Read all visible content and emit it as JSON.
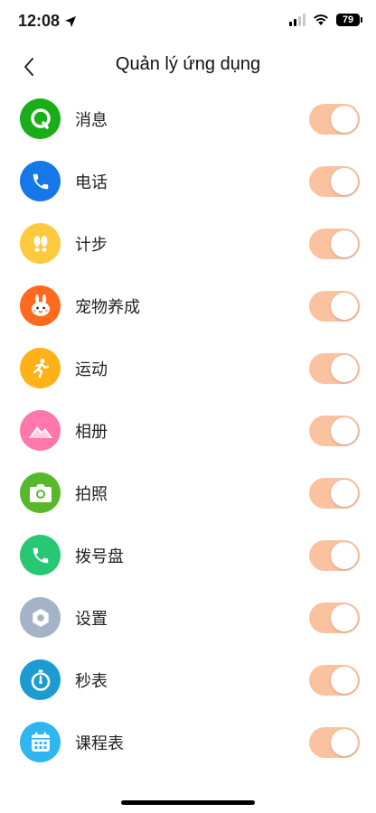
{
  "status_bar": {
    "time": "12:08",
    "battery": "79"
  },
  "header": {
    "title": "Quản lý ứng dụng"
  },
  "apps": [
    {
      "name": "消息",
      "icon": "message-icon",
      "color": "#1aad19",
      "enabled": true
    },
    {
      "name": "电话",
      "icon": "phone-icon",
      "color": "#1677e8",
      "enabled": true
    },
    {
      "name": "计步",
      "icon": "footsteps-icon",
      "color": "#ffc93e",
      "enabled": true
    },
    {
      "name": "宠物养成",
      "icon": "pet-rabbit-icon",
      "color": "#ff6a1f",
      "enabled": true
    },
    {
      "name": "运动",
      "icon": "running-icon",
      "color": "#ffb218",
      "enabled": true
    },
    {
      "name": "相册",
      "icon": "album-mountain-icon",
      "color": "#ff77ab",
      "enabled": true
    },
    {
      "name": "拍照",
      "icon": "camera-icon",
      "color": "#58b82c",
      "enabled": true
    },
    {
      "name": "拨号盘",
      "icon": "dialpad-phone-icon",
      "color": "#27c774",
      "enabled": true
    },
    {
      "name": "设置",
      "icon": "settings-hex-icon",
      "color": "#a4b4c8",
      "enabled": true
    },
    {
      "name": "秒表",
      "icon": "stopwatch-icon",
      "color": "#1d9bd1",
      "enabled": true
    },
    {
      "name": "课程表",
      "icon": "calendar-icon",
      "color": "#2fb6f0",
      "enabled": true
    }
  ],
  "colors": {
    "toggle_on": "#fbc2a0"
  }
}
